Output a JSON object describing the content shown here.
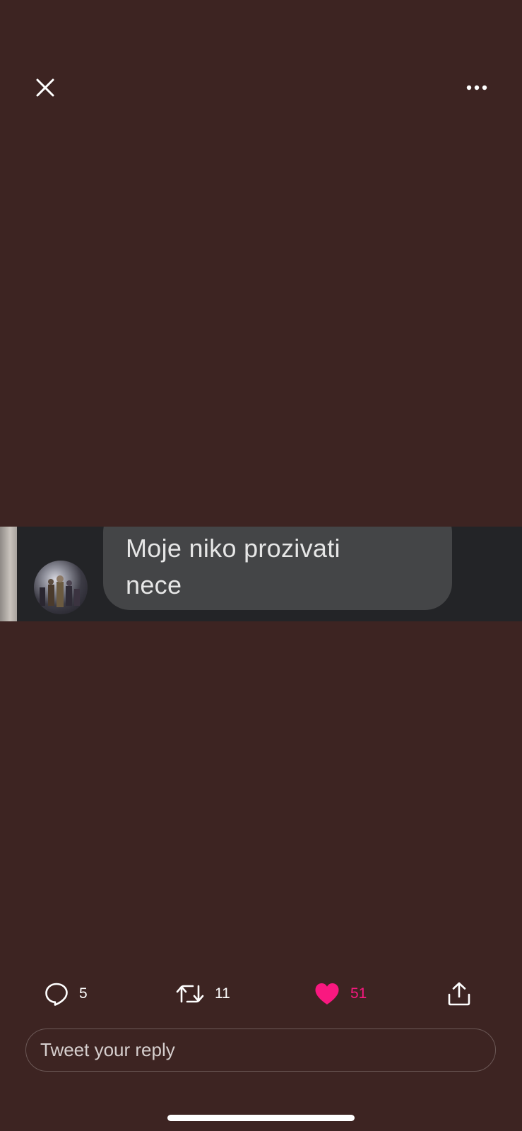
{
  "header": {
    "close_icon": "close-icon",
    "more_icon": "more-horizontal-icon"
  },
  "media": {
    "message_text_line1": "Moje niko prozivati",
    "message_text_line2": "nece"
  },
  "actions": {
    "reply_icon": "reply-bubble-icon",
    "reply_count": "5",
    "retweet_icon": "retweet-icon",
    "retweet_count": "11",
    "like_icon": "heart-filled-icon",
    "like_count": "51",
    "like_color": "#f91880",
    "share_icon": "share-upload-icon"
  },
  "composer": {
    "placeholder": "Tweet your reply"
  },
  "colors": {
    "background": "#3d2422",
    "accent_like": "#f91880"
  }
}
